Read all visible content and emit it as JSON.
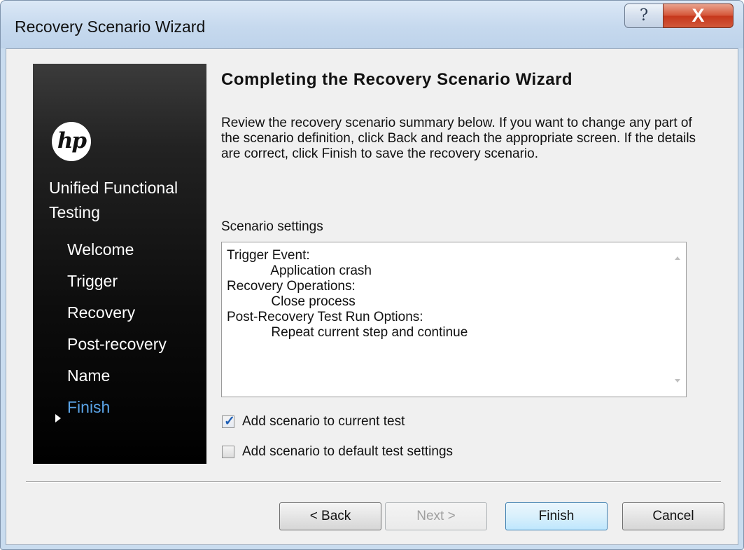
{
  "window": {
    "title": "Recovery Scenario Wizard",
    "help_glyph": "?",
    "close_glyph": "X"
  },
  "sidebar": {
    "logo_text": "hp",
    "product_name": "Unified Functional Testing",
    "steps": [
      {
        "label": "Welcome",
        "active": false
      },
      {
        "label": "Trigger",
        "active": false
      },
      {
        "label": "Recovery",
        "active": false
      },
      {
        "label": "Post-recovery",
        "active": false
      },
      {
        "label": "Name",
        "active": false
      },
      {
        "label": "Finish",
        "active": true
      }
    ]
  },
  "main": {
    "title": "Completing the Recovery Scenario Wizard",
    "description": "Review the recovery scenario summary below. If you want to change any part of the scenario definition, click Back and reach the appropriate screen. If the details are correct, click Finish to save the recovery scenario.",
    "settings_label": "Scenario settings",
    "settings_lines": [
      "Trigger Event:",
      "            Application crash",
      "Recovery Operations:",
      "            Close process",
      "Post-Recovery Test Run Options:",
      "            Repeat current step and continue"
    ],
    "checkboxes": [
      {
        "label": "Add scenario to current test",
        "checked": true
      },
      {
        "label": "Add scenario to default test settings",
        "checked": false
      }
    ]
  },
  "buttons": {
    "back": "< Back",
    "next": "Next >",
    "finish": "Finish",
    "cancel": "Cancel"
  },
  "colors": {
    "active_step": "#5aa3e6",
    "sidebar_background": "#000000",
    "close_button": "#c6371c"
  }
}
